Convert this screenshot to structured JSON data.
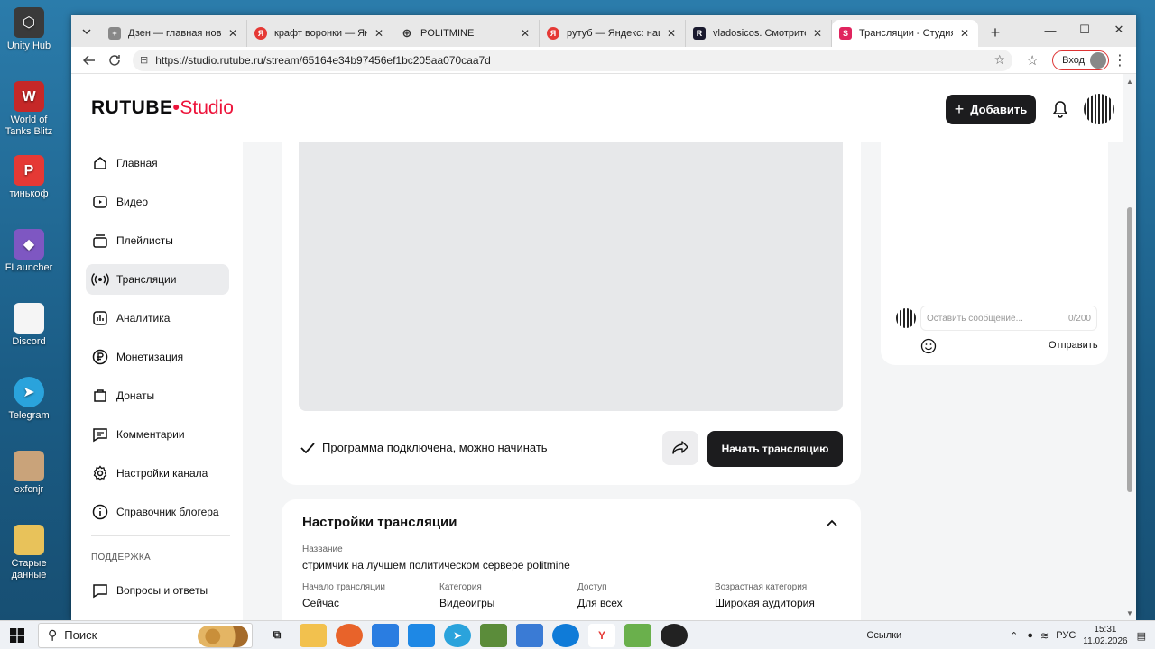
{
  "desktop": {
    "icons": [
      {
        "label": "Unity Hub",
        "color": "#3a3a3a",
        "glyph": "⬡"
      },
      {
        "label": "World of Tanks Blitz",
        "color": "#c62828",
        "glyph": "W"
      },
      {
        "label": "тинькоф",
        "color": "#e53935",
        "glyph": "P"
      },
      {
        "label": "FLauncher",
        "color": "#7e57c2",
        "glyph": "◆"
      },
      {
        "label": "Discord",
        "color": "#f5f5f5",
        "glyph": ""
      },
      {
        "label": "Telegram",
        "color": "#2aa3dc",
        "glyph": "➤"
      },
      {
        "label": "exfcnjr",
        "color": "#c9a37a",
        "glyph": ""
      },
      {
        "label": "Старые данные",
        "color": "#e8c25a",
        "glyph": ""
      }
    ]
  },
  "browser": {
    "tabs": [
      {
        "title": "Дзен — главная новости",
        "fav_color": "#888",
        "fav_glyph": "+"
      },
      {
        "title": "крафт воронки — Яндекс",
        "fav_color": "#e53935",
        "fav_glyph": "Я"
      },
      {
        "title": "POLITMINE",
        "fav_color": "#555",
        "fav_glyph": "⊕"
      },
      {
        "title": "рутуб — Яндекс: нашлось",
        "fav_color": "#e53935",
        "fav_glyph": "Я"
      },
      {
        "title": "vladosicos. Смотрите видео",
        "fav_color": "#1a1a2e",
        "fav_glyph": "R"
      },
      {
        "title": "Трансляции - Студия Rutube",
        "fav_color": "#e0245e",
        "fav_glyph": "S"
      }
    ],
    "active_tab": 5,
    "url": "https://studio.rutube.ru/stream/65164e34b97456ef1bc205aa070caa7d",
    "login_label": "Вход"
  },
  "app": {
    "logo_main": "RUTUBE",
    "logo_studio": "Studio",
    "add_label": "Добавить",
    "nav": [
      {
        "label": "Главная",
        "icon": "home-icon"
      },
      {
        "label": "Видео",
        "icon": "video-icon"
      },
      {
        "label": "Плейлисты",
        "icon": "playlist-icon"
      },
      {
        "label": "Трансляции",
        "icon": "broadcast-icon"
      },
      {
        "label": "Аналитика",
        "icon": "analytics-icon"
      },
      {
        "label": "Монетизация",
        "icon": "ruble-icon"
      },
      {
        "label": "Донаты",
        "icon": "donate-icon"
      },
      {
        "label": "Комментарии",
        "icon": "comment-icon"
      },
      {
        "label": "Настройки канала",
        "icon": "gear-icon"
      },
      {
        "label": "Справочник блогера",
        "icon": "info-icon"
      }
    ],
    "support_section": "ПОДДЕРЖКА",
    "support_item": "Вопросы и ответы",
    "stream": {
      "status_text": "Программа подключена, можно начинать",
      "start_label": "Начать трансляцию"
    },
    "settings": {
      "title": "Настройки трансляции",
      "name_label": "Название",
      "name_value": "стримчик на лучшем политическом сервере politmine",
      "fields": [
        {
          "label": "Начало трансляции",
          "value": "Сейчас"
        },
        {
          "label": "Категория",
          "value": "Видеоигры"
        },
        {
          "label": "Доступ",
          "value": "Для всех"
        },
        {
          "label": "Возрастная категория",
          "value": "Широкая аудитория"
        }
      ]
    },
    "chat": {
      "placeholder": "Оставить сообщение...",
      "counter": "0/200",
      "send_label": "Отправить"
    }
  },
  "taskbar": {
    "search_label": "Поиск",
    "links_label": "Ссылки",
    "lang": "РУС",
    "time": "15:31",
    "date": "11.02.2026"
  }
}
